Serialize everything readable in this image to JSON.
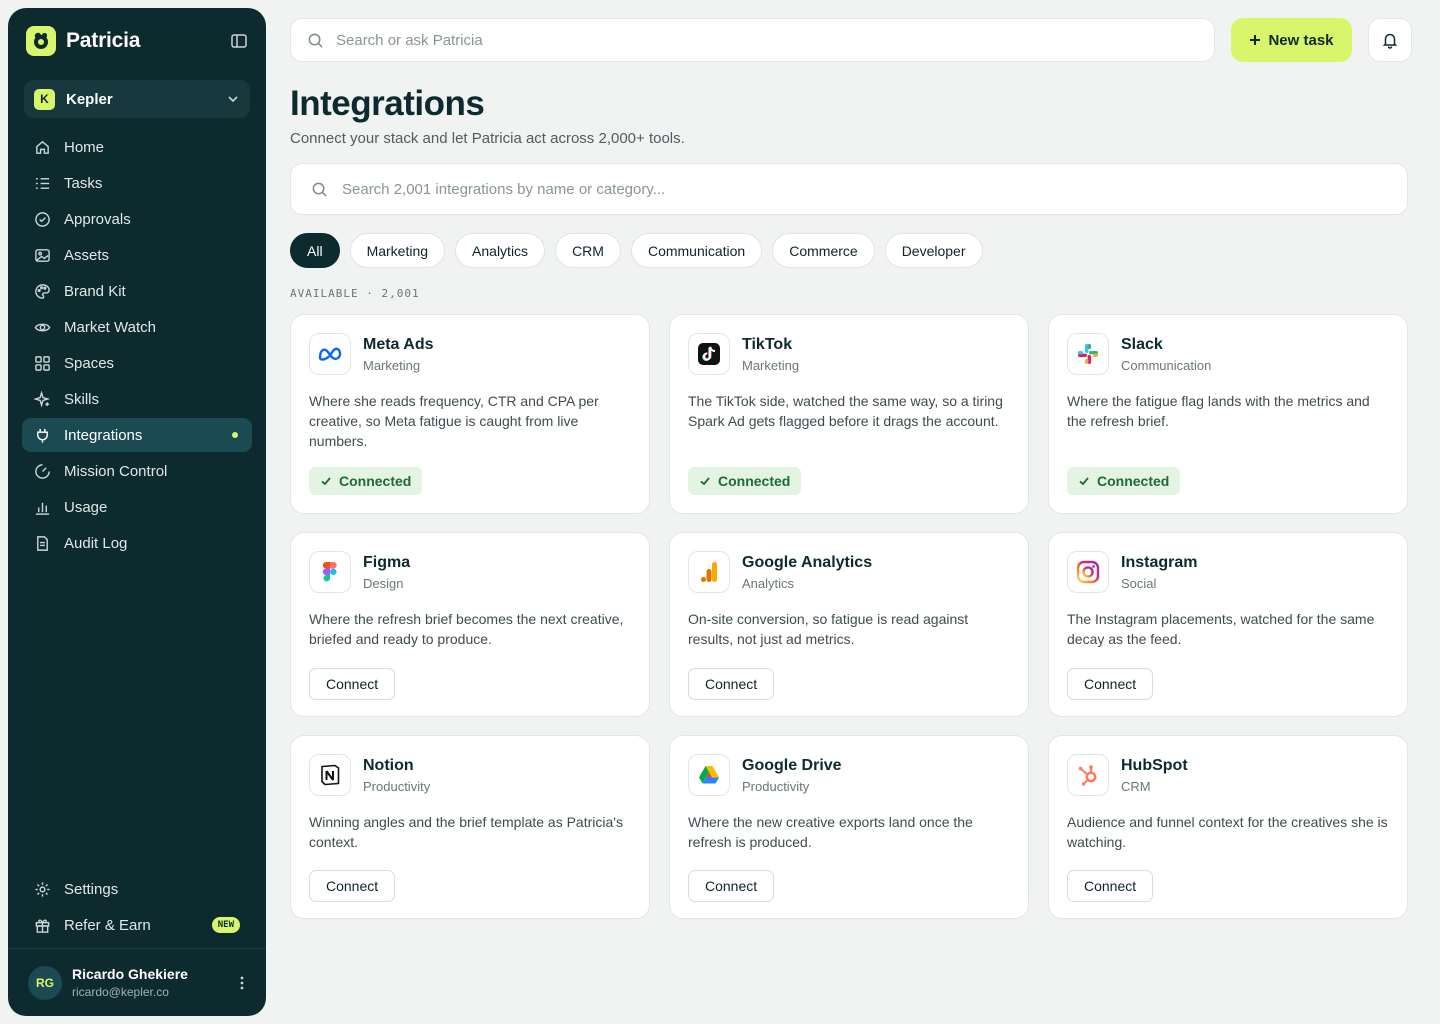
{
  "brand": {
    "name": "Patricia"
  },
  "workspace": {
    "initial": "K",
    "name": "Kepler"
  },
  "nav": [
    {
      "label": "Home",
      "icon": "home-icon"
    },
    {
      "label": "Tasks",
      "icon": "list-icon"
    },
    {
      "label": "Approvals",
      "icon": "check-circle-icon"
    },
    {
      "label": "Assets",
      "icon": "image-icon"
    },
    {
      "label": "Brand Kit",
      "icon": "palette-icon"
    },
    {
      "label": "Market Watch",
      "icon": "eye-icon"
    },
    {
      "label": "Spaces",
      "icon": "grid-icon"
    },
    {
      "label": "Skills",
      "icon": "sparkle-icon"
    },
    {
      "label": "Integrations",
      "icon": "plug-icon",
      "active": true
    },
    {
      "label": "Mission Control",
      "icon": "gauge-icon"
    },
    {
      "label": "Usage",
      "icon": "bar-chart-icon"
    },
    {
      "label": "Audit Log",
      "icon": "document-icon"
    }
  ],
  "nav_bottom": [
    {
      "label": "Settings",
      "icon": "gear-icon"
    },
    {
      "label": "Refer & Earn",
      "icon": "gift-icon",
      "badge": "NEW"
    }
  ],
  "user": {
    "initials": "RG",
    "name": "Ricardo Ghekiere",
    "email": "ricardo@kepler.co"
  },
  "topbar": {
    "search_placeholder": "Search or ask Patricia",
    "new_task_label": "New task"
  },
  "page": {
    "title": "Integrations",
    "subtitle": "Connect your stack and let Patricia act across 2,000+ tools.",
    "search_placeholder": "Search 2,001 integrations by name or category...",
    "available_label": "AVAILABLE · 2,001"
  },
  "filters": [
    "All",
    "Marketing",
    "Analytics",
    "CRM",
    "Communication",
    "Commerce",
    "Developer"
  ],
  "integrations": [
    {
      "name": "Meta Ads",
      "category": "Marketing",
      "description": "Where she reads frequency, CTR and CPA per creative, so Meta fatigue is caught from live numbers.",
      "status": "Connected",
      "icon": "meta-icon"
    },
    {
      "name": "TikTok",
      "category": "Marketing",
      "description": "The TikTok side, watched the same way, so a tiring Spark Ad gets flagged before it drags the account.",
      "status": "Connected",
      "icon": "tiktok-icon"
    },
    {
      "name": "Slack",
      "category": "Communication",
      "description": "Where the fatigue flag lands with the metrics and the refresh brief.",
      "status": "Connected",
      "icon": "slack-icon"
    },
    {
      "name": "Figma",
      "category": "Design",
      "description": "Where the refresh brief becomes the next creative, briefed and ready to produce.",
      "action": "Connect",
      "icon": "figma-icon"
    },
    {
      "name": "Google Analytics",
      "category": "Analytics",
      "description": "On-site conversion, so fatigue is read against results, not just ad metrics.",
      "action": "Connect",
      "icon": "google-analytics-icon"
    },
    {
      "name": "Instagram",
      "category": "Social",
      "description": "The Instagram placements, watched for the same decay as the feed.",
      "action": "Connect",
      "icon": "instagram-icon"
    },
    {
      "name": "Notion",
      "category": "Productivity",
      "description": "Winning angles and the brief template as Patricia's context.",
      "action": "Connect",
      "icon": "notion-icon"
    },
    {
      "name": "Google Drive",
      "category": "Productivity",
      "description": "Where the new creative exports land once the refresh is produced.",
      "action": "Connect",
      "icon": "google-drive-icon"
    },
    {
      "name": "HubSpot",
      "category": "CRM",
      "description": "Audience and funnel context for the creatives she is watching.",
      "action": "Connect",
      "icon": "hubspot-icon"
    }
  ],
  "colors": {
    "sidebar": "#0d2a2f",
    "accent": "#d7f66b",
    "connected_bg": "#e3f3e4",
    "connected_text": "#1f6b35"
  }
}
